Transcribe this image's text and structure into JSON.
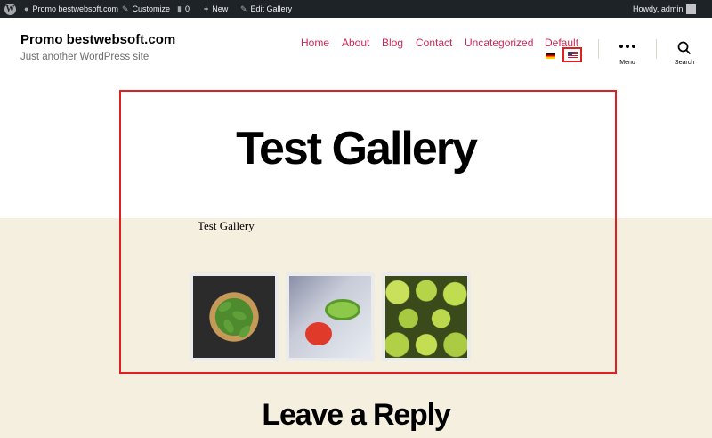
{
  "admin_bar": {
    "site_name": "Promo bestwebsoft.com",
    "customize": "Customize",
    "comments_count": "0",
    "new": "New",
    "edit": "Edit Gallery",
    "greeting": "Howdy, admin"
  },
  "header": {
    "site_title": "Promo bestwebsoft.com",
    "site_description": "Just another WordPress site",
    "nav": [
      "Home",
      "About",
      "Blog",
      "Contact",
      "Uncategorized",
      "Default"
    ],
    "menu_label": "Menu",
    "search_label": "Search"
  },
  "page": {
    "title": "Test Gallery",
    "gallery_caption": "Test Gallery",
    "images": [
      "basil",
      "salad",
      "pears"
    ],
    "reply_title": "Leave a Reply"
  },
  "colors": {
    "accent": "#cd2653",
    "admin_bar": "#1d2327",
    "content_bg": "#f5efe0",
    "highlight": "#e02020"
  }
}
